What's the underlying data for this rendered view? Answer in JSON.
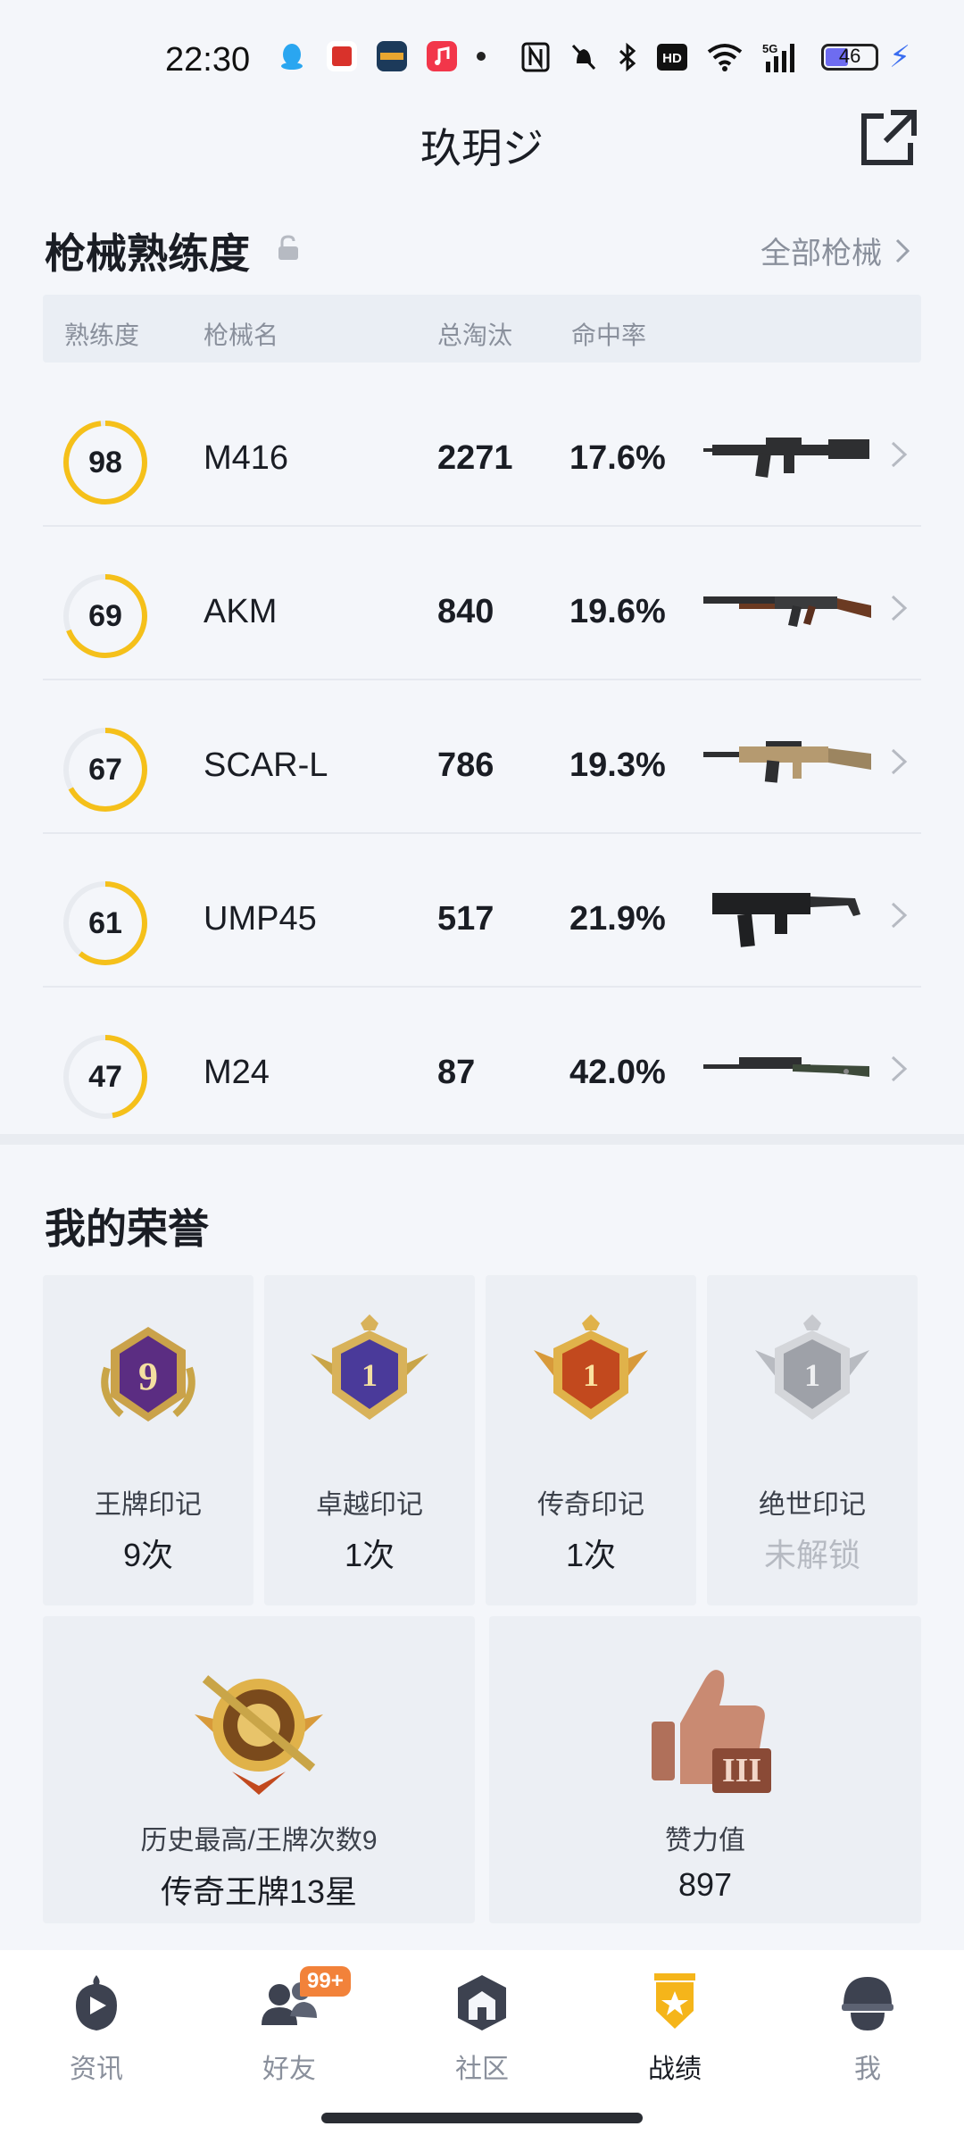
{
  "status_bar": {
    "time": "22:30",
    "network": "5G",
    "hd": "HD",
    "battery_level": "46",
    "icons": [
      "qq-icon",
      "app-icon",
      "game-icon",
      "music-icon",
      "nfc-icon",
      "mute-icon",
      "bluetooth-icon",
      "hd-icon",
      "wifi-icon",
      "signal-icon",
      "battery-icon",
      "charging-icon"
    ]
  },
  "header": {
    "title": "玖玥ジ",
    "share_icon": "share-icon"
  },
  "weapons": {
    "section_title": "枪械熟练度",
    "all_link": "全部枪械",
    "columns": [
      "熟练度",
      "枪械名",
      "总淘汰",
      "命中率"
    ],
    "rows": [
      {
        "proficiency": "98",
        "level": 0.98,
        "name": "M416",
        "kills": "2271",
        "hit_rate": "17.6%",
        "icon": "m416-rifle-icon"
      },
      {
        "proficiency": "69",
        "level": 0.69,
        "name": "AKM",
        "kills": "840",
        "hit_rate": "19.6%",
        "icon": "akm-rifle-icon"
      },
      {
        "proficiency": "67",
        "level": 0.67,
        "name": "SCAR-L",
        "kills": "786",
        "hit_rate": "19.3%",
        "icon": "scar-rifle-icon"
      },
      {
        "proficiency": "61",
        "level": 0.61,
        "name": "UMP45",
        "kills": "517",
        "hit_rate": "21.9%",
        "icon": "ump45-smg-icon"
      },
      {
        "proficiency": "47",
        "level": 0.47,
        "name": "M24",
        "kills": "87",
        "hit_rate": "42.0%",
        "icon": "m24-sniper-icon"
      }
    ]
  },
  "honors": {
    "section_title": "我的荣誉",
    "cards": [
      {
        "label": "王牌印记",
        "count": "9次",
        "icon": "ace-mark-icon"
      },
      {
        "label": "卓越印记",
        "count": "1次",
        "icon": "excellence-mark-icon"
      },
      {
        "label": "传奇印记",
        "count": "1次",
        "icon": "legend-mark-icon"
      },
      {
        "label": "绝世印记",
        "count": "未解锁",
        "icon": "peerless-mark-icon",
        "locked": true
      }
    ],
    "big_cards": [
      {
        "label": "历史最高/王牌次数9",
        "value": "传奇王牌13星",
        "icon": "legend-ace-badge-icon"
      },
      {
        "label": "赞力值",
        "value": "897",
        "icon": "thumbs-up-icon"
      }
    ]
  },
  "bottom_nav": {
    "items": [
      {
        "label": "资讯",
        "icon": "news-icon"
      },
      {
        "label": "好友",
        "icon": "friends-icon",
        "badge": "99+"
      },
      {
        "label": "社区",
        "icon": "community-icon"
      },
      {
        "label": "战绩",
        "icon": "record-icon",
        "active": true
      },
      {
        "label": "我",
        "icon": "profile-icon"
      }
    ]
  },
  "colors": {
    "ring": "#f5c01a",
    "ring_track": "#e8ebf0",
    "accent_orange": "#f2823a",
    "active_nav": "#f5b51a"
  }
}
